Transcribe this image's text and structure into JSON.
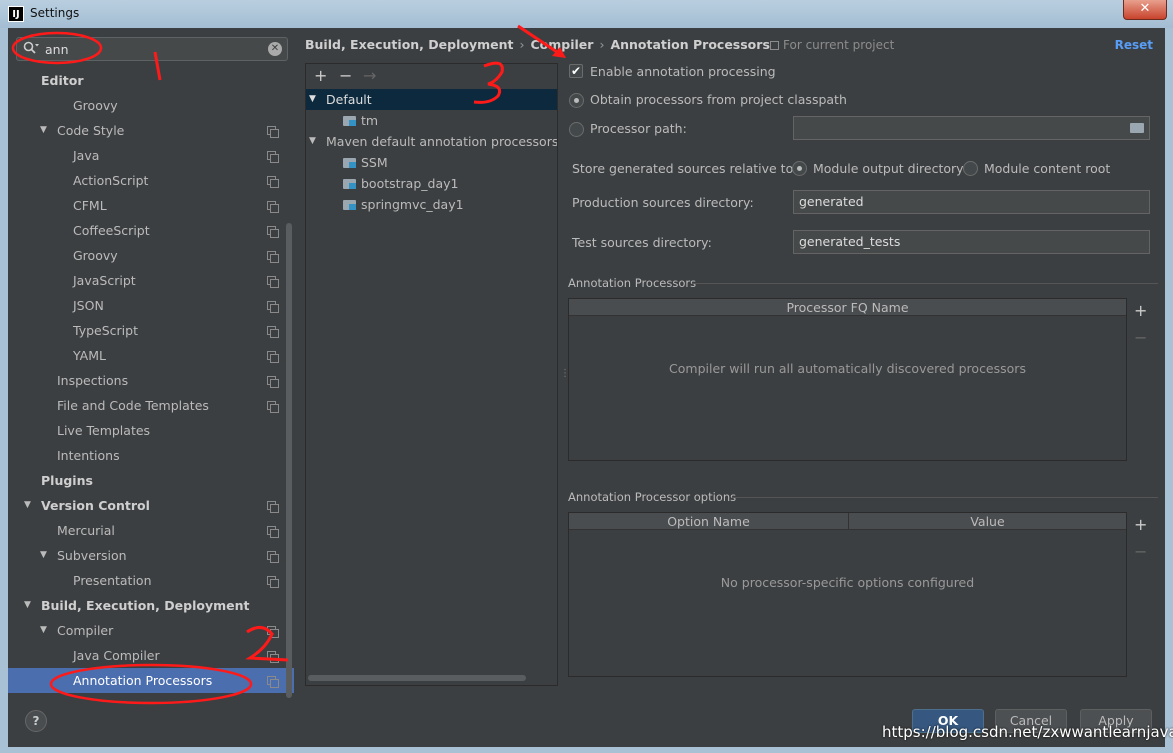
{
  "window": {
    "title": "Settings",
    "app_icon": "IJ",
    "close_glyph": "✕"
  },
  "search": {
    "value": "ann",
    "icon": "search-icon",
    "clear": "✕"
  },
  "sidebar": {
    "items": [
      {
        "label": "Editor",
        "level": 0,
        "bold": true,
        "arrow": "",
        "copy": false
      },
      {
        "label": "Groovy",
        "level": 2,
        "bold": false,
        "arrow": "",
        "copy": false
      },
      {
        "label": "Code Style",
        "level": 1,
        "bold": false,
        "arrow": "▼",
        "copy": true
      },
      {
        "label": "Java",
        "level": 2,
        "bold": false,
        "arrow": "",
        "copy": true
      },
      {
        "label": "ActionScript",
        "level": 2,
        "bold": false,
        "arrow": "",
        "copy": true
      },
      {
        "label": "CFML",
        "level": 2,
        "bold": false,
        "arrow": "",
        "copy": true
      },
      {
        "label": "CoffeeScript",
        "level": 2,
        "bold": false,
        "arrow": "",
        "copy": true
      },
      {
        "label": "Groovy",
        "level": 2,
        "bold": false,
        "arrow": "",
        "copy": true
      },
      {
        "label": "JavaScript",
        "level": 2,
        "bold": false,
        "arrow": "",
        "copy": true
      },
      {
        "label": "JSON",
        "level": 2,
        "bold": false,
        "arrow": "",
        "copy": true
      },
      {
        "label": "TypeScript",
        "level": 2,
        "bold": false,
        "arrow": "",
        "copy": true
      },
      {
        "label": "YAML",
        "level": 2,
        "bold": false,
        "arrow": "",
        "copy": true
      },
      {
        "label": "Inspections",
        "level": 1,
        "bold": false,
        "arrow": "",
        "copy": true
      },
      {
        "label": "File and Code Templates",
        "level": 1,
        "bold": false,
        "arrow": "",
        "copy": true
      },
      {
        "label": "Live Templates",
        "level": 1,
        "bold": false,
        "arrow": "",
        "copy": false
      },
      {
        "label": "Intentions",
        "level": 1,
        "bold": false,
        "arrow": "",
        "copy": false
      },
      {
        "label": "Plugins",
        "level": 0,
        "bold": true,
        "arrow": "",
        "copy": false
      },
      {
        "label": "Version Control",
        "level": 0,
        "bold": true,
        "arrow": "▼",
        "copy": true
      },
      {
        "label": "Mercurial",
        "level": 1,
        "bold": false,
        "arrow": "",
        "copy": true
      },
      {
        "label": "Subversion",
        "level": 1,
        "bold": false,
        "arrow": "▼",
        "copy": true
      },
      {
        "label": "Presentation",
        "level": 2,
        "bold": false,
        "arrow": "",
        "copy": true
      },
      {
        "label": "Build, Execution, Deployment",
        "level": 0,
        "bold": true,
        "arrow": "▼",
        "copy": false
      },
      {
        "label": "Compiler",
        "level": 1,
        "bold": false,
        "arrow": "▼",
        "copy": true
      },
      {
        "label": "Java Compiler",
        "level": 2,
        "bold": false,
        "arrow": "",
        "copy": true
      },
      {
        "label": "Annotation Processors",
        "level": 2,
        "bold": false,
        "arrow": "",
        "copy": true,
        "selected": true
      }
    ]
  },
  "breadcrumb": {
    "parts": [
      "Build, Execution, Deployment",
      "Compiler",
      "Annotation Processors"
    ],
    "sep": "›",
    "scope": "For current project",
    "reset": "Reset"
  },
  "profiles": {
    "toolbar": {
      "add": "+",
      "remove": "−",
      "move": "→"
    },
    "rows": [
      {
        "label": "Default",
        "arrow": "▼",
        "indent": 0,
        "folder": false,
        "selected": true
      },
      {
        "label": "tm",
        "arrow": "",
        "indent": 2,
        "folder": true
      },
      {
        "label": "Maven default annotation processors profile",
        "arrow": "▼",
        "indent": 0,
        "folder": false
      },
      {
        "label": "SSM",
        "arrow": "",
        "indent": 2,
        "folder": true
      },
      {
        "label": "bootstrap_day1",
        "arrow": "",
        "indent": 2,
        "folder": true
      },
      {
        "label": "springmvc_day1",
        "arrow": "",
        "indent": 2,
        "folder": true
      }
    ]
  },
  "form": {
    "enable_processing": {
      "label": "Enable annotation processing",
      "checked": true,
      "check_glyph": "✔"
    },
    "obtain_classpath": {
      "label": "Obtain processors from project classpath",
      "selected": true
    },
    "processor_path": {
      "label": "Processor path:",
      "value": "",
      "selected": false
    },
    "store_relative": {
      "label": "Store generated sources relative to:",
      "options": [
        {
          "label": "Module output directory",
          "selected": true
        },
        {
          "label": "Module content root",
          "selected": false
        }
      ]
    },
    "production_dir": {
      "label": "Production sources directory:",
      "value": "generated"
    },
    "test_dir": {
      "label": "Test sources directory:",
      "value": "generated_tests"
    },
    "processors_section": {
      "title": "Annotation Processors",
      "column": "Processor FQ Name",
      "empty": "Compiler will run all automatically discovered processors",
      "add": "+",
      "remove": "−"
    },
    "options_section": {
      "title": "Annotation Processor options",
      "columns": [
        "Option Name",
        "Value"
      ],
      "empty": "No processor-specific options configured",
      "add": "+",
      "remove": "−"
    }
  },
  "buttons": {
    "help": "?",
    "ok": "OK",
    "cancel": "Cancel",
    "apply": "Apply"
  },
  "watermark": "https://blog.csdn.net/zxwwantlearnjava",
  "annotations": {
    "one": "1",
    "two": "2",
    "three": "3"
  },
  "colors": {
    "background": "#3c3f41",
    "selection": "#4b6eaf",
    "link": "#589df6",
    "annotation": "#ff1a1a"
  }
}
